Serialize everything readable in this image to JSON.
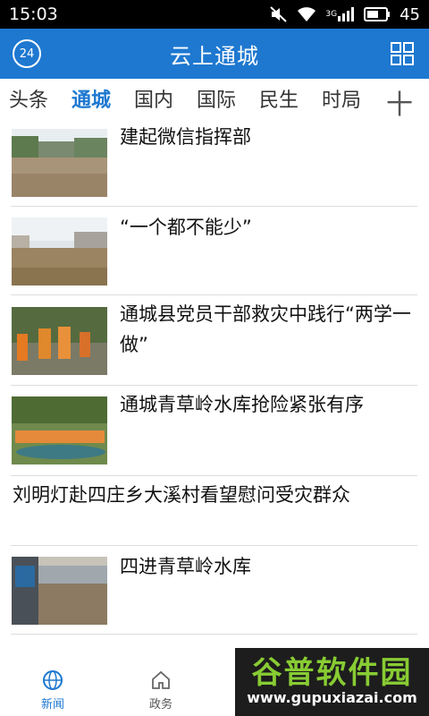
{
  "status_bar": {
    "time": "15:03",
    "network": "3G",
    "battery": "45"
  },
  "app_bar": {
    "title": "云上通城",
    "badge": "24"
  },
  "tabs": [
    {
      "label": "头条"
    },
    {
      "label": "通城"
    },
    {
      "label": "国内"
    },
    {
      "label": "国际"
    },
    {
      "label": "民生"
    },
    {
      "label": "时局"
    }
  ],
  "tab_add": "十",
  "news": [
    {
      "title": "建起微信指挥部"
    },
    {
      "title": "“一个都不能少”"
    },
    {
      "title": "通城县党员干部救灾中践行“两学一做”"
    },
    {
      "title": " 通城青草岭水库抢险紧张有序"
    },
    {
      "title": "刘明灯赴四庄乡大溪村看望慰问受灾群众"
    },
    {
      "title": "四进青草岭水库"
    }
  ],
  "bottom_nav": [
    {
      "label": "新闻"
    },
    {
      "label": "政务"
    }
  ],
  "watermark": {
    "title": "谷普软件园",
    "url": "www.gupuxiazai.com"
  },
  "colors": {
    "accent": "#1e78d0",
    "divider": "#dddddd"
  }
}
